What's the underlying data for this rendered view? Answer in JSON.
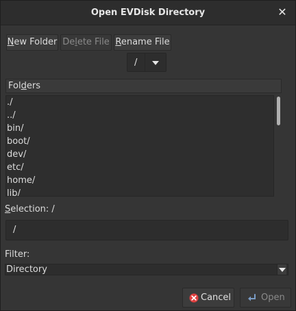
{
  "window": {
    "title": "Open EVDisk Directory",
    "close_glyph": "✕"
  },
  "toolbar": {
    "new_folder_prefix": "",
    "new_folder_mnemonic": "N",
    "new_folder_rest": "ew Folder",
    "delete_file_pre": "De",
    "delete_file_mnemonic": "l",
    "delete_file_rest": "ete File",
    "rename_file_mnemonic": "R",
    "rename_file_rest": "ename File"
  },
  "path_combo": {
    "value": "/",
    "arrow_icon": "chevron-down-icon"
  },
  "folders": {
    "header_pre": "Fol",
    "header_mnemonic": "d",
    "header_rest": "ers",
    "items": [
      "./",
      "../",
      "bin/",
      "boot/",
      "dev/",
      "etc/",
      "home/",
      "lib/"
    ]
  },
  "selection": {
    "label_mnemonic": "S",
    "label_rest": "election: /",
    "value": "/"
  },
  "filter": {
    "label": "Filter:",
    "selected": "Directory"
  },
  "actions": {
    "cancel_label": "Cancel",
    "cancel_icon": "cancel-icon",
    "open_label": "Open",
    "open_icon": "open-arrow-icon",
    "cancel_icon_color": "#e04040",
    "open_icon_color": "#7a9cc6"
  }
}
